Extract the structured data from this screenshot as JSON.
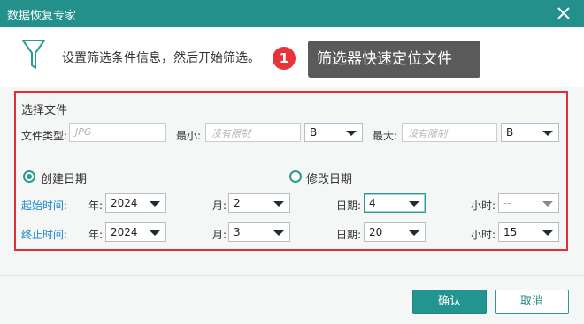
{
  "window": {
    "title": "数据恢复专家"
  },
  "header": {
    "hint": "设置筛选条件信息，然后开始筛选。"
  },
  "annotation": {
    "badge": "1",
    "tooltip": "筛选器快速定位文件"
  },
  "filter": {
    "section_title": "选择文件",
    "file_type_label": "文件类型:",
    "file_type_placeholder": "JPG",
    "min_label": "最小:",
    "min_placeholder": "没有限制",
    "min_unit": "B",
    "max_label": "最大:",
    "max_placeholder": "没有限制",
    "max_unit": "B"
  },
  "date_mode": {
    "created_label": "创建日期",
    "modified_label": "修改日期",
    "selected": "created"
  },
  "start": {
    "label": "起始时间:",
    "year_label": "年:",
    "year": "2024",
    "month_label": "月:",
    "month": "2",
    "day_label": "日期:",
    "day": "4",
    "hour_label": "小时:",
    "hour": "--"
  },
  "end": {
    "label": "终止时间:",
    "year_label": "年:",
    "year": "2024",
    "month_label": "月:",
    "month": "3",
    "day_label": "日期:",
    "day": "20",
    "hour_label": "小时:",
    "hour": "15"
  },
  "footer": {
    "confirm": "确认",
    "cancel": "取消"
  },
  "colors": {
    "titlebar": "#23908c",
    "accent": "#239591",
    "highlight_frame": "#e02e3a",
    "link_label": "#1e88c8",
    "tooltip_bg": "#5a5a5a"
  }
}
